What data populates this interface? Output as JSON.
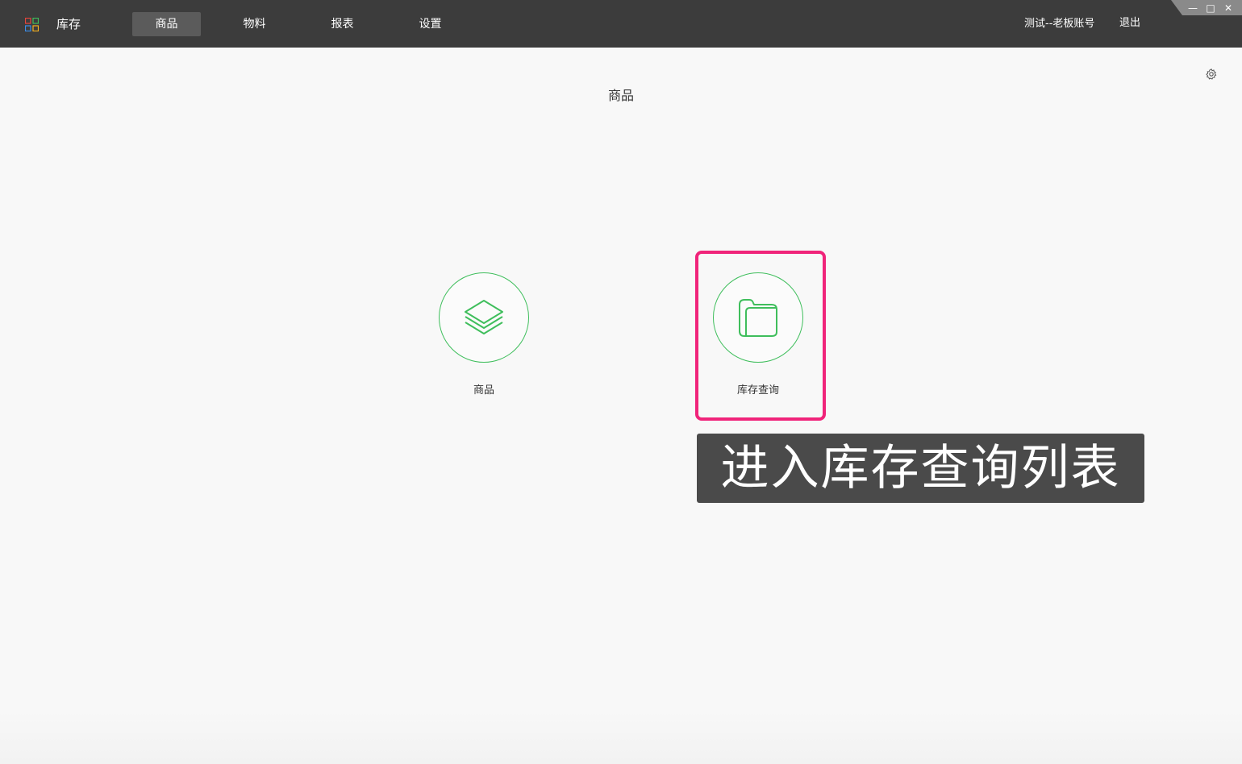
{
  "app": {
    "title": "库存",
    "logo_icon": "grid-apps-icon"
  },
  "nav": {
    "items": [
      {
        "label": "商品",
        "active": true
      },
      {
        "label": "物料",
        "active": false
      },
      {
        "label": "报表",
        "active": false
      },
      {
        "label": "设置",
        "active": false
      }
    ]
  },
  "header": {
    "account": "测试--老板账号",
    "logout": "退出"
  },
  "window_controls": {
    "minimize": "—",
    "maximize": "□",
    "close": "✕"
  },
  "main": {
    "title": "商品",
    "tiles": [
      {
        "label": "商品",
        "icon": "layers-icon"
      },
      {
        "label": "库存查询",
        "icon": "folder-icon"
      }
    ]
  },
  "overlay": {
    "tooltip": "进入库存查询列表",
    "highlight_color": "#f0247a"
  },
  "colors": {
    "accent": "#3fbe5c",
    "topbar": "#3c3c3c"
  }
}
